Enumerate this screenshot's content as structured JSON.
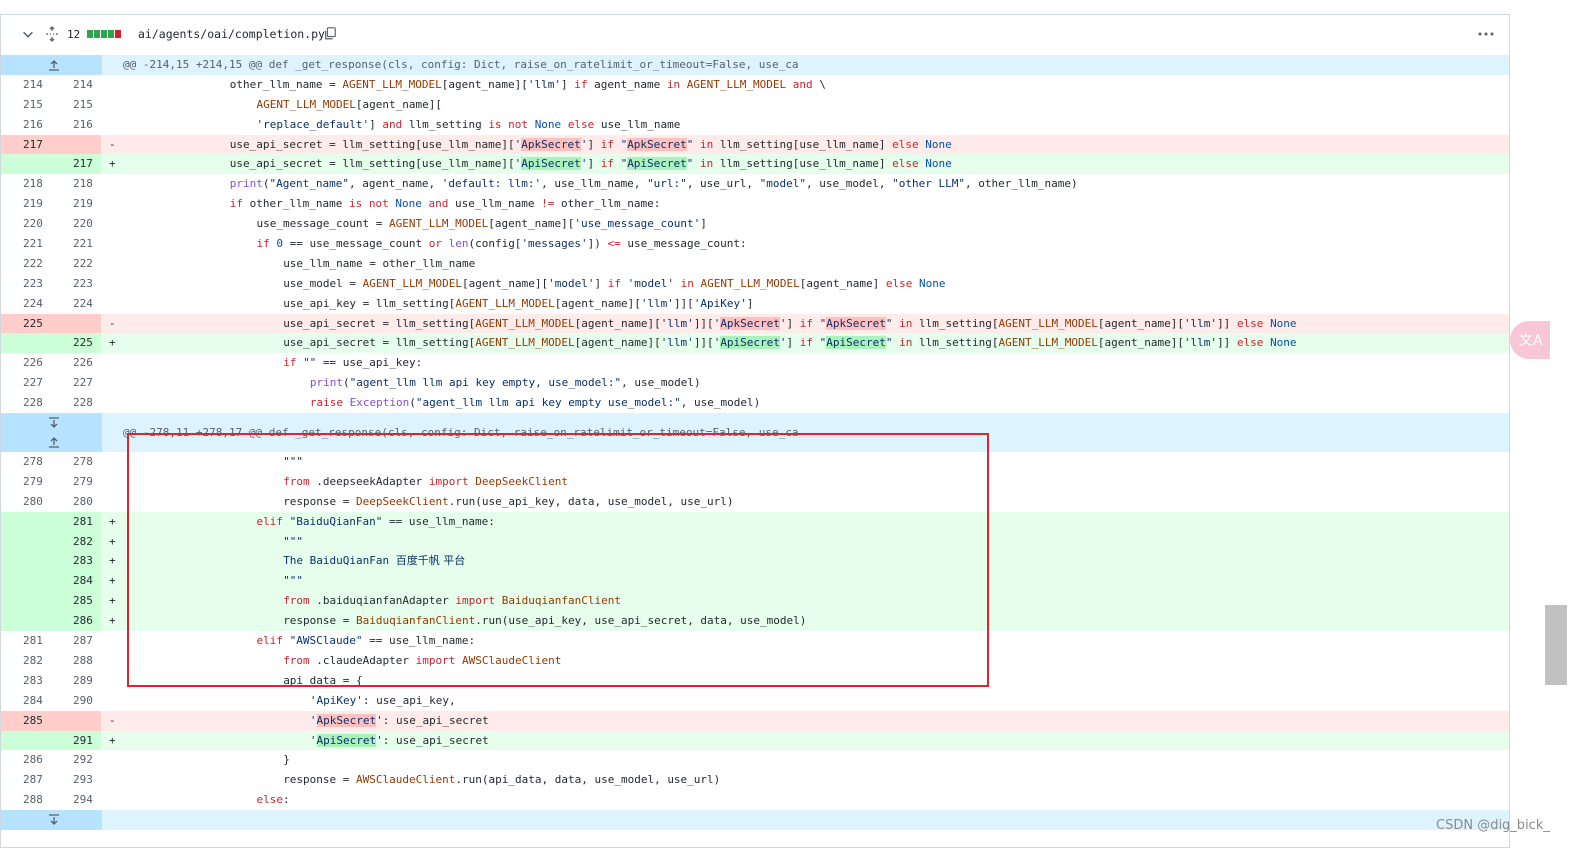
{
  "file": {
    "count": "12",
    "path": "ai/agents/oai/completion.py",
    "diffstat": [
      "#2da44e",
      "#2da44e",
      "#2da44e",
      "#2da44e",
      "#cf222e"
    ]
  },
  "hunks": [
    "@@ -214,15 +214,15 @@ def _get_response(cls, config: Dict, raise_on_ratelimit_or_timeout=False, use_ca",
    "@@ -278,11 +278,17 @@ def _get_response(cls, config: Dict, raise_on_ratelimit_or_timeout=False, use_ca"
  ],
  "rows": [
    {
      "t": "hunk",
      "h": 0
    },
    {
      "t": "ctx",
      "a": "214",
      "b": "214",
      "i": 4,
      "tok": [
        [
          "",
          "other_llm_name = "
        ],
        [
          "const",
          "AGENT_LLM_MODEL"
        ],
        [
          "",
          "[agent_name]["
        ],
        [
          "str",
          "'llm'"
        ],
        [
          "",
          "] "
        ],
        [
          "kw",
          "if"
        ],
        [
          "",
          " agent_name "
        ],
        [
          "kw",
          "in"
        ],
        [
          "",
          ""
        ],
        [
          "const",
          " AGENT_LLM_MODEL"
        ],
        [
          "",
          " "
        ],
        [
          "kw",
          "and"
        ],
        [
          "",
          " \\"
        ]
      ]
    },
    {
      "t": "ctx",
      "a": "215",
      "b": "215",
      "i": 5,
      "tok": [
        [
          "const",
          "AGENT_LLM_MODEL"
        ],
        [
          "",
          "[agent_name]["
        ]
      ]
    },
    {
      "t": "ctx",
      "a": "216",
      "b": "216",
      "i": 5,
      "tok": [
        [
          "str",
          "'replace_default'"
        ],
        [
          "",
          "] "
        ],
        [
          "kw",
          "and"
        ],
        [
          "",
          " llm_setting "
        ],
        [
          "kw",
          "is not"
        ],
        [
          "",
          " "
        ],
        [
          "cst",
          "None"
        ],
        [
          "",
          " "
        ],
        [
          "kw",
          "else"
        ],
        [
          "",
          " use_llm_name"
        ]
      ]
    },
    {
      "t": "del",
      "a": "217",
      "b": "",
      "i": 4,
      "tok": [
        [
          "",
          "use_api_secret = llm_setting[use_llm_name]["
        ],
        [
          "str",
          "'"
        ],
        [
          "hld",
          "ApkSecret"
        ],
        [
          "str",
          "'"
        ],
        [
          "",
          "] "
        ],
        [
          "kw",
          "if"
        ],
        [
          "",
          " "
        ],
        [
          "str",
          "\""
        ],
        [
          "hld",
          "ApkSecret"
        ],
        [
          "str",
          "\""
        ],
        [
          "",
          " "
        ],
        [
          "kw",
          "in"
        ],
        [
          "",
          " llm_setting[use_llm_name] "
        ],
        [
          "kw",
          "else"
        ],
        [
          "",
          " "
        ],
        [
          "cst",
          "None"
        ]
      ]
    },
    {
      "t": "add",
      "a": "",
      "b": "217",
      "i": 4,
      "tok": [
        [
          "",
          "use_api_secret = llm_setting[use_llm_name]["
        ],
        [
          "str",
          "'"
        ],
        [
          "hla",
          "ApiSecret"
        ],
        [
          "str",
          "'"
        ],
        [
          "",
          "] "
        ],
        [
          "kw",
          "if"
        ],
        [
          "",
          " "
        ],
        [
          "str",
          "\""
        ],
        [
          "hla",
          "ApiSecret"
        ],
        [
          "str",
          "\""
        ],
        [
          "",
          " "
        ],
        [
          "kw",
          "in"
        ],
        [
          "",
          " llm_setting[use_llm_name] "
        ],
        [
          "kw",
          "else"
        ],
        [
          "",
          " "
        ],
        [
          "cst",
          "None"
        ]
      ]
    },
    {
      "t": "ctx",
      "a": "218",
      "b": "218",
      "i": 4,
      "tok": [
        [
          "fn",
          "print"
        ],
        [
          "",
          "("
        ],
        [
          "str",
          "\"Agent_name\""
        ],
        [
          "",
          ", agent_name, "
        ],
        [
          "str",
          "'default: llm:'"
        ],
        [
          "",
          ", use_llm_name, "
        ],
        [
          "str",
          "\"url:\""
        ],
        [
          "",
          ", use_url, "
        ],
        [
          "str",
          "\"model\""
        ],
        [
          "",
          ", use_model, "
        ],
        [
          "str",
          "\"other LLM\""
        ],
        [
          "",
          ", other_llm_name)"
        ]
      ]
    },
    {
      "t": "ctx",
      "a": "219",
      "b": "219",
      "i": 4,
      "tok": [
        [
          "kw",
          "if"
        ],
        [
          "",
          " other_llm_name "
        ],
        [
          "kw",
          "is not"
        ],
        [
          "",
          " "
        ],
        [
          "cst",
          "None"
        ],
        [
          "",
          " "
        ],
        [
          "kw",
          "and"
        ],
        [
          "",
          " use_llm_name "
        ],
        [
          "kw",
          "!="
        ],
        [
          "",
          " other_llm_name:"
        ]
      ]
    },
    {
      "t": "ctx",
      "a": "220",
      "b": "220",
      "i": 5,
      "tok": [
        [
          "",
          "use_message_count = "
        ],
        [
          "const",
          "AGENT_LLM_MODEL"
        ],
        [
          "",
          "[agent_name]["
        ],
        [
          "str",
          "'use_message_count'"
        ],
        [
          "",
          "]"
        ]
      ]
    },
    {
      "t": "ctx",
      "a": "221",
      "b": "221",
      "i": 5,
      "tok": [
        [
          "kw",
          "if"
        ],
        [
          "",
          " "
        ],
        [
          "cst",
          "0"
        ],
        [
          "",
          " == use_message_count "
        ],
        [
          "kw",
          "or"
        ],
        [
          "",
          " "
        ],
        [
          "fn",
          "len"
        ],
        [
          "",
          "(config["
        ],
        [
          "str",
          "'messages'"
        ],
        [
          "",
          "]) "
        ],
        [
          "kw",
          "<="
        ],
        [
          "",
          " use_message_count:"
        ]
      ]
    },
    {
      "t": "ctx",
      "a": "222",
      "b": "222",
      "i": 6,
      "tok": [
        [
          "",
          "use_llm_name = other_llm_name"
        ]
      ]
    },
    {
      "t": "ctx",
      "a": "223",
      "b": "223",
      "i": 6,
      "tok": [
        [
          "",
          "use_model = "
        ],
        [
          "const",
          "AGENT_LLM_MODEL"
        ],
        [
          "",
          "[agent_name]["
        ],
        [
          "str",
          "'model'"
        ],
        [
          "",
          "] "
        ],
        [
          "kw",
          "if"
        ],
        [
          "",
          " "
        ],
        [
          "str",
          "'model'"
        ],
        [
          "",
          " "
        ],
        [
          "kw",
          "in"
        ],
        [
          "",
          " "
        ],
        [
          "const",
          "AGENT_LLM_MODEL"
        ],
        [
          "",
          "[agent_name] "
        ],
        [
          "kw",
          "else"
        ],
        [
          "",
          " "
        ],
        [
          "cst",
          "None"
        ]
      ]
    },
    {
      "t": "ctx",
      "a": "224",
      "b": "224",
      "i": 6,
      "tok": [
        [
          "",
          "use_api_key = llm_setting["
        ],
        [
          "const",
          "AGENT_LLM_MODEL"
        ],
        [
          "",
          "[agent_name]["
        ],
        [
          "str",
          "'llm'"
        ],
        [
          "",
          "]]["
        ],
        [
          "str",
          "'ApiKey'"
        ],
        [
          "",
          "]"
        ]
      ]
    },
    {
      "t": "del",
      "a": "225",
      "b": "",
      "i": 6,
      "tok": [
        [
          "",
          "use_api_secret = llm_setting["
        ],
        [
          "const",
          "AGENT_LLM_MODEL"
        ],
        [
          "",
          "[agent_name]["
        ],
        [
          "str",
          "'llm'"
        ],
        [
          "",
          "]]["
        ],
        [
          "str",
          "'"
        ],
        [
          "hld",
          "ApkSecret"
        ],
        [
          "str",
          "'"
        ],
        [
          "",
          "] "
        ],
        [
          "kw",
          "if"
        ],
        [
          "",
          " "
        ],
        [
          "str",
          "\""
        ],
        [
          "hld",
          "ApkSecret"
        ],
        [
          "str",
          "\""
        ],
        [
          "",
          " "
        ],
        [
          "kw",
          "in"
        ],
        [
          "",
          " llm_setting["
        ],
        [
          "const",
          "AGENT_LLM_MODEL"
        ],
        [
          "",
          "[agent_name]["
        ],
        [
          "str",
          "'llm'"
        ],
        [
          "",
          "]] "
        ],
        [
          "kw",
          "else"
        ],
        [
          "",
          " "
        ],
        [
          "cst",
          "None"
        ]
      ]
    },
    {
      "t": "add",
      "a": "",
      "b": "225",
      "i": 6,
      "tok": [
        [
          "",
          "use_api_secret = llm_setting["
        ],
        [
          "const",
          "AGENT_LLM_MODEL"
        ],
        [
          "",
          "[agent_name]["
        ],
        [
          "str",
          "'llm'"
        ],
        [
          "",
          "]]["
        ],
        [
          "str",
          "'"
        ],
        [
          "hla",
          "ApiSecret"
        ],
        [
          "str",
          "'"
        ],
        [
          "",
          "] "
        ],
        [
          "kw",
          "if"
        ],
        [
          "",
          " "
        ],
        [
          "str",
          "\""
        ],
        [
          "hla",
          "ApiSecret"
        ],
        [
          "str",
          "\""
        ],
        [
          "",
          " "
        ],
        [
          "kw",
          "in"
        ],
        [
          "",
          " llm_setting["
        ],
        [
          "const",
          "AGENT_LLM_MODEL"
        ],
        [
          "",
          "[agent_name]["
        ],
        [
          "str",
          "'llm'"
        ],
        [
          "",
          "]] "
        ],
        [
          "kw",
          "else"
        ],
        [
          "",
          " "
        ],
        [
          "cst",
          "None"
        ]
      ]
    },
    {
      "t": "ctx",
      "a": "226",
      "b": "226",
      "i": 6,
      "tok": [
        [
          "kw",
          "if"
        ],
        [
          "",
          " "
        ],
        [
          "str",
          "\"\""
        ],
        [
          "",
          " == use_api_key:"
        ]
      ]
    },
    {
      "t": "ctx",
      "a": "227",
      "b": "227",
      "i": 7,
      "tok": [
        [
          "fn",
          "print"
        ],
        [
          "",
          "("
        ],
        [
          "str",
          "\"agent_llm llm api key empty, use_model:\""
        ],
        [
          "",
          ", use_model)"
        ]
      ]
    },
    {
      "t": "ctx",
      "a": "228",
      "b": "228",
      "i": 7,
      "tok": [
        [
          "kw",
          "raise"
        ],
        [
          "",
          " "
        ],
        [
          "fn",
          "Exception"
        ],
        [
          "",
          "("
        ],
        [
          "str",
          "\"agent_llm llm api key empty use_model:\""
        ],
        [
          "",
          ", use_model)"
        ]
      ]
    },
    {
      "t": "hunk2",
      "h": 1
    },
    {
      "t": "ctx",
      "a": "278",
      "b": "278",
      "i": 6,
      "tok": [
        [
          "str",
          "\"\"\""
        ]
      ]
    },
    {
      "t": "ctx",
      "a": "279",
      "b": "279",
      "i": 6,
      "tok": [
        [
          "kw",
          "from"
        ],
        [
          "",
          " .deepseekAdapter "
        ],
        [
          "kw",
          "import"
        ],
        [
          "",
          " "
        ],
        [
          "const",
          "DeepSeekClient"
        ]
      ]
    },
    {
      "t": "ctx",
      "a": "280",
      "b": "280",
      "i": 6,
      "tok": [
        [
          "",
          "response = "
        ],
        [
          "const",
          "DeepSeekClient"
        ],
        [
          "",
          ".run(use_api_key, data, use_model, use_url)"
        ]
      ]
    },
    {
      "t": "add",
      "a": "",
      "b": "281",
      "i": 5,
      "tok": [
        [
          "kw",
          "elif"
        ],
        [
          "",
          " "
        ],
        [
          "str",
          "\"BaiduQianFan\""
        ],
        [
          "",
          " == use_llm_name:"
        ]
      ]
    },
    {
      "t": "add",
      "a": "",
      "b": "282",
      "i": 6,
      "tok": [
        [
          "str",
          "\"\"\""
        ]
      ]
    },
    {
      "t": "add",
      "a": "",
      "b": "283",
      "i": 6,
      "tok": [
        [
          "str",
          "The BaiduQianFan "
        ],
        [
          "zh",
          "百度千帆 平台"
        ]
      ]
    },
    {
      "t": "add",
      "a": "",
      "b": "284",
      "i": 6,
      "tok": [
        [
          "str",
          "\"\"\""
        ]
      ]
    },
    {
      "t": "add",
      "a": "",
      "b": "285",
      "i": 6,
      "tok": [
        [
          "kw",
          "from"
        ],
        [
          "",
          " .baiduqianfanAdapter "
        ],
        [
          "kw",
          "import"
        ],
        [
          "",
          " "
        ],
        [
          "const",
          "BaiduqianfanClient"
        ]
      ]
    },
    {
      "t": "add",
      "a": "",
      "b": "286",
      "i": 6,
      "tok": [
        [
          "",
          "response = "
        ],
        [
          "const",
          "BaiduqianfanClient"
        ],
        [
          "",
          ".run(use_api_key, use_api_secret, data, use_model)"
        ]
      ]
    },
    {
      "t": "ctx",
      "a": "281",
      "b": "287",
      "i": 5,
      "tok": [
        [
          "kw",
          "elif"
        ],
        [
          "",
          " "
        ],
        [
          "str",
          "\"AWSClaude\""
        ],
        [
          "",
          " == use_llm_name:"
        ]
      ]
    },
    {
      "t": "ctx",
      "a": "282",
      "b": "288",
      "i": 6,
      "tok": [
        [
          "kw",
          "from"
        ],
        [
          "",
          " .claudeAdapter "
        ],
        [
          "kw",
          "import"
        ],
        [
          "",
          " "
        ],
        [
          "const",
          "AWSClaudeClient"
        ]
      ]
    },
    {
      "t": "ctx",
      "a": "283",
      "b": "289",
      "i": 6,
      "tok": [
        [
          "",
          "api_data = {"
        ]
      ]
    },
    {
      "t": "ctx",
      "a": "284",
      "b": "290",
      "i": 7,
      "tok": [
        [
          "str",
          "'ApiKey'"
        ],
        [
          "",
          ": use_api_key,"
        ]
      ]
    },
    {
      "t": "del",
      "a": "285",
      "b": "",
      "i": 7,
      "tok": [
        [
          "str",
          "'"
        ],
        [
          "hld",
          "ApkSecret"
        ],
        [
          "str",
          "'"
        ],
        [
          "",
          ": use_api_secret"
        ]
      ]
    },
    {
      "t": "add",
      "a": "",
      "b": "291",
      "i": 7,
      "tok": [
        [
          "str",
          "'"
        ],
        [
          "hla",
          "ApiSecret"
        ],
        [
          "str",
          "'"
        ],
        [
          "",
          ": use_api_secret"
        ]
      ]
    },
    {
      "t": "ctx",
      "a": "286",
      "b": "292",
      "i": 6,
      "tok": [
        [
          "",
          "}"
        ]
      ]
    },
    {
      "t": "ctx",
      "a": "287",
      "b": "293",
      "i": 6,
      "tok": [
        [
          "",
          "response = "
        ],
        [
          "const",
          "AWSClaudeClient"
        ],
        [
          "",
          ".run(api_data, data, use_model, use_url)"
        ]
      ]
    },
    {
      "t": "ctx",
      "a": "288",
      "b": "294",
      "i": 5,
      "tok": [
        [
          "kw",
          "else"
        ],
        [
          "",
          ":"
        ]
      ]
    },
    {
      "t": "expand-end"
    }
  ],
  "watermark": "CSDN @dig_bick_"
}
